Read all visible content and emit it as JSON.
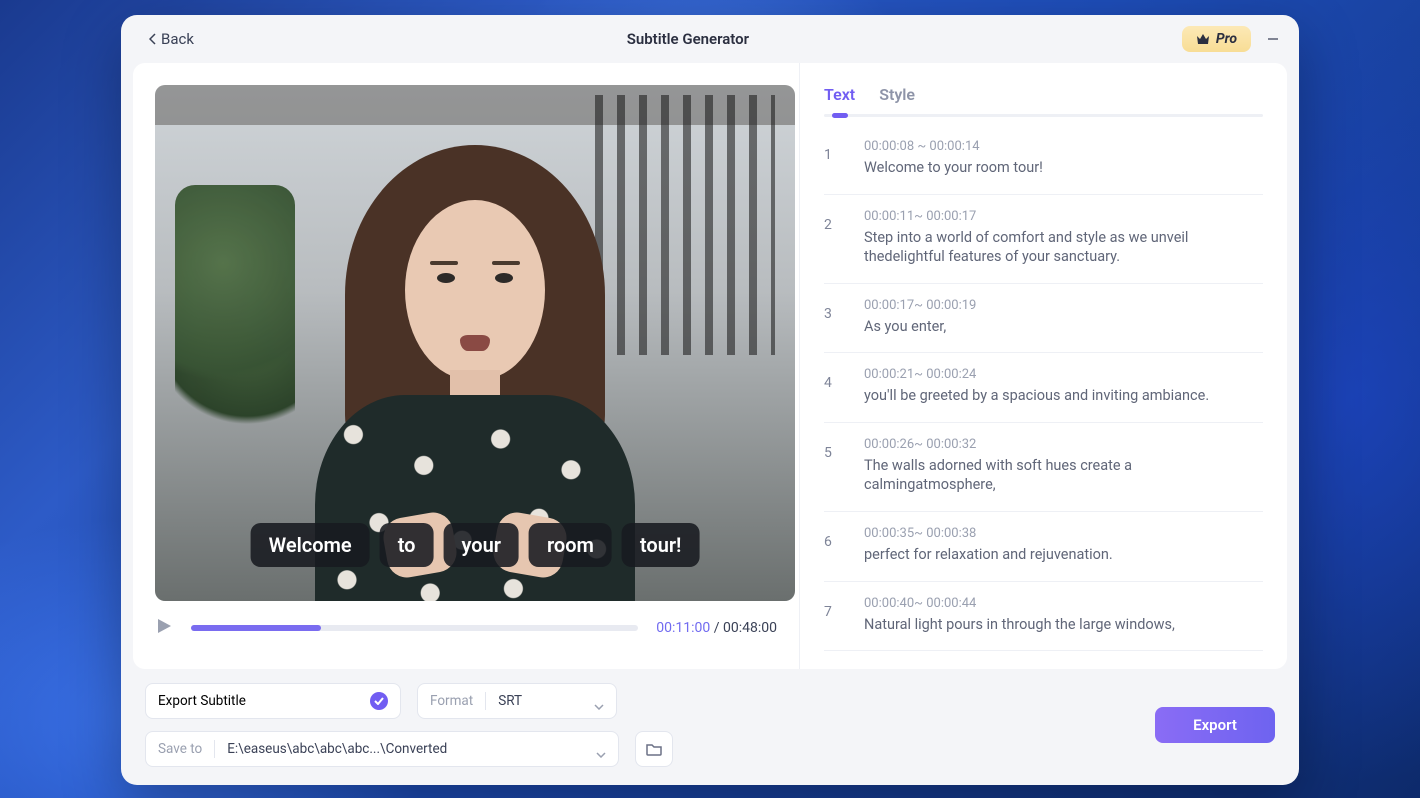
{
  "header": {
    "back_label": "Back",
    "title": "Subtitle Generator",
    "pro_label": "Pro"
  },
  "video": {
    "caption_words": [
      "Welcome",
      "to",
      "your",
      "room",
      "tour!"
    ],
    "current_time": "00:11:00",
    "total_time": "00:48:00",
    "progress_percent": 29
  },
  "tabs": {
    "text": "Text",
    "style": "Style",
    "active": "text"
  },
  "subtitles": [
    {
      "idx": "1",
      "time": "00:00:08 ~ 00:00:14",
      "text": "Welcome to your room tour!"
    },
    {
      "idx": "2",
      "time": "00:00:11~ 00:00:17",
      "text": "Step into a world of comfort and style as we unveil thedelightful features of your sanctuary."
    },
    {
      "idx": "3",
      "time": "00:00:17~ 00:00:19",
      "text": "As you enter,"
    },
    {
      "idx": "4",
      "time": "00:00:21~ 00:00:24",
      "text": "you'll be greeted by a spacious and inviting ambiance."
    },
    {
      "idx": "5",
      "time": "00:00:26~ 00:00:32",
      "text": "The walls adorned with soft hues create a calmingatmosphere,"
    },
    {
      "idx": "6",
      "time": "00:00:35~ 00:00:38",
      "text": "perfect for relaxation and rejuvenation."
    },
    {
      "idx": "7",
      "time": "00:00:40~ 00:00:44",
      "text": "Natural light pours in through the large windows,"
    }
  ],
  "export": {
    "subtitle_label": "Export Subtitle",
    "format_label": "Format",
    "format_value": "SRT",
    "save_to_label": "Save to",
    "save_to_path": "E:\\easeus\\abc\\abc\\abc...\\Converted",
    "button_label": "Export"
  }
}
